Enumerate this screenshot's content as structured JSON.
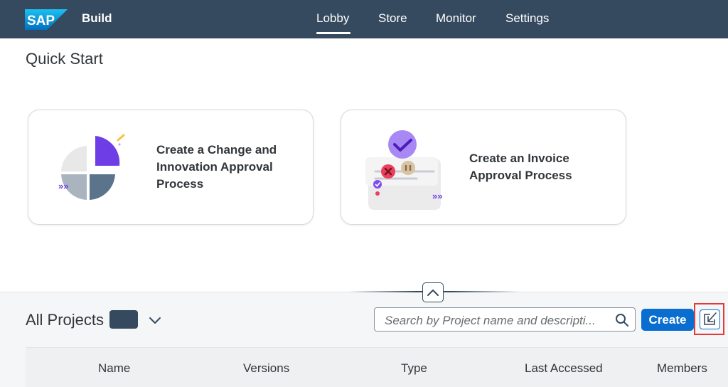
{
  "shell": {
    "logo_text": "SAP",
    "product": "Build",
    "nav": [
      "Lobby",
      "Store",
      "Monitor",
      "Settings"
    ],
    "active_nav": "Lobby"
  },
  "quick_start": {
    "title": "Quick Start",
    "cards": [
      {
        "label": "Create a Change and Innovation Approval Process"
      },
      {
        "label": "Create an Invoice Approval Process"
      }
    ]
  },
  "projects": {
    "title": "All Projects",
    "search_placeholder": "Search by Project name and descripti...",
    "create_label": "Create",
    "columns": [
      "Name",
      "Versions",
      "Type",
      "Last Accessed",
      "Members"
    ]
  },
  "colors": {
    "shell": "#354a5f",
    "accent": "#0a6ed1",
    "highlight": "#e4393c",
    "purple": "#6e3de6"
  }
}
